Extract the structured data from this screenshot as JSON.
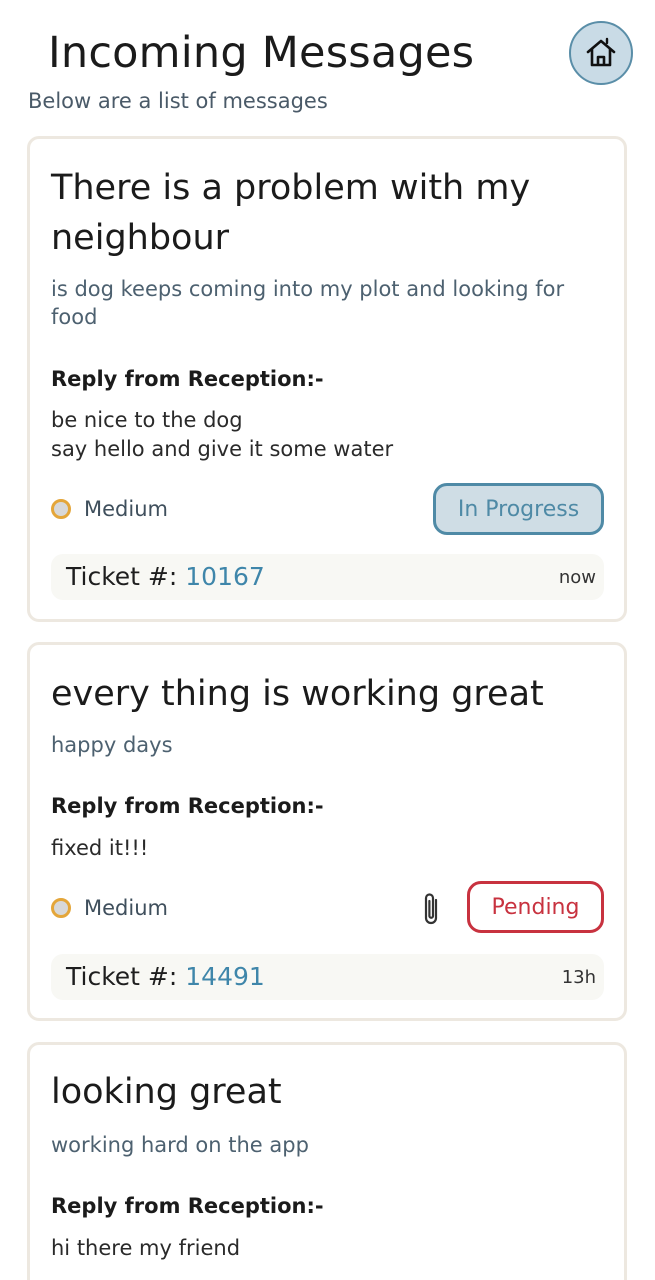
{
  "header": {
    "title": "Incoming Messages",
    "subtitle": "Below are a list of messages",
    "home_icon": "home-icon"
  },
  "messages": [
    {
      "title": "There is a problem with my neighbour",
      "description": "is dog keeps coming into my plot and looking for food",
      "reply_heading": "Reply from Reception:-",
      "reply_body": "be nice to the dog\nsay hello and give it some water",
      "priority": "Medium",
      "status": "In Progress",
      "has_attachment": false,
      "ticket_label": "Ticket #:",
      "ticket_number": "10167",
      "time": "now"
    },
    {
      "title": "every thing is working great",
      "description": "happy days",
      "reply_heading": "Reply from Reception:-",
      "reply_body": "fixed it!!!",
      "priority": "Medium",
      "status": "Pending",
      "has_attachment": true,
      "attachment_icon": "paperclip-icon",
      "ticket_label": "Ticket #:",
      "ticket_number": "14491",
      "time": "13h"
    },
    {
      "title": "looking great",
      "description": "working hard on the app",
      "reply_heading": "Reply from Reception:-",
      "reply_body": "hi there my friend"
    }
  ],
  "colors": {
    "accent_blue": "#4f8aa6",
    "pending_red": "#c8323f",
    "priority_medium": "#e4a63a",
    "card_border": "#ede8e0"
  }
}
